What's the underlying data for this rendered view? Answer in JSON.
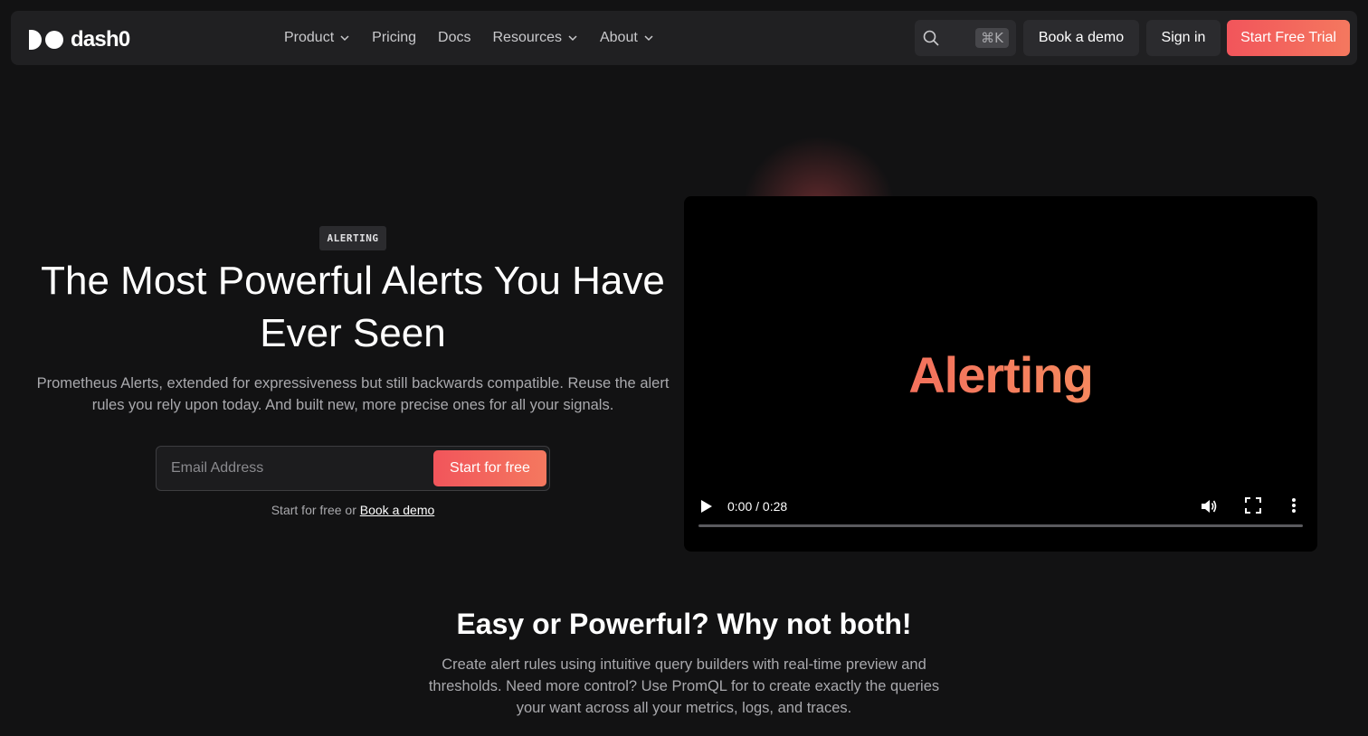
{
  "nav": {
    "logo_text": "dash0",
    "menu": [
      {
        "label": "Product",
        "has_dropdown": true
      },
      {
        "label": "Pricing",
        "has_dropdown": false
      },
      {
        "label": "Docs",
        "has_dropdown": false
      },
      {
        "label": "Resources",
        "has_dropdown": true
      },
      {
        "label": "About",
        "has_dropdown": true
      }
    ],
    "search_shortcut": "⌘K",
    "book_demo": "Book a demo",
    "sign_in": "Sign in",
    "start_trial": "Start Free Trial"
  },
  "hero": {
    "badge": "ALERTING",
    "title": "The Most Powerful Alerts You Have Ever Seen",
    "subtitle": "Prometheus Alerts, extended for expressiveness but still backwards compatible. Reuse the alert rules you rely upon today. And built new, more precise ones for all your signals.",
    "email_placeholder": "Email Address",
    "cta": "Start for free",
    "note_prefix": "Start for free or",
    "note_link": "Book a demo"
  },
  "video": {
    "word": "Alerting",
    "time": "0:00 / 0:28",
    "progress": 0
  },
  "section2": {
    "title": "Easy or Powerful? Why not both!",
    "subtitle": "Create alert rules using intuitive query builders with real-time preview and thresholds. Need more control? Use PromQL for to create exactly the queries your want across all your metrics, logs, and traces."
  },
  "colors": {
    "accent_start": "#f2555b",
    "accent_end": "#f4785f",
    "background": "#121213",
    "nav_bg": "#202022"
  }
}
